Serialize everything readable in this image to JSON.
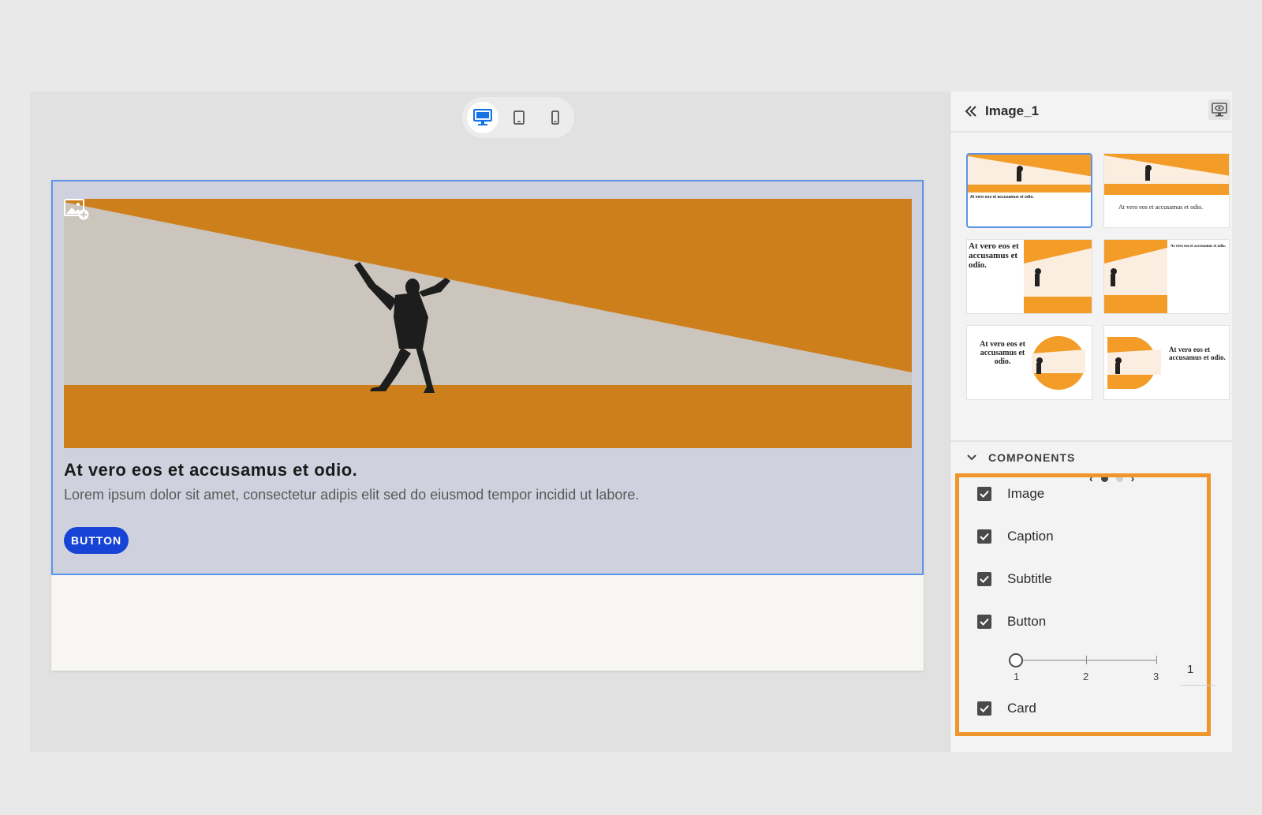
{
  "panel": {
    "title": "Image_1",
    "components_title": "COMPONENTS",
    "components": [
      {
        "label": "Image",
        "checked": true
      },
      {
        "label": "Caption",
        "checked": true
      },
      {
        "label": "Subtitle",
        "checked": true
      },
      {
        "label": "Button",
        "checked": true
      },
      {
        "label": "Card",
        "checked": true
      }
    ],
    "button_count": {
      "ticks": [
        "1",
        "2",
        "3"
      ],
      "value": "1"
    },
    "templates": [
      {
        "text": "At vero eos et accusamus et odio."
      },
      {
        "text": "At vero eos et accusamus et odio."
      },
      {
        "text": "At vero eos et accusamus et odio."
      },
      {
        "text": "At vero eos et accusamus et odio."
      },
      {
        "text": "At vero eos et accusamus et odio."
      },
      {
        "text": "At vero eos et accusamus et odio."
      }
    ],
    "pager": {
      "pages": 2,
      "current": 1
    }
  },
  "card": {
    "caption": "At vero eos et accusamus et odio.",
    "subtitle": "Lorem ipsum dolor sit amet, consectetur adipis elit sed do eiusmod tempor incidid ut labore.",
    "button": "BUTTON"
  },
  "colors": {
    "accent": "#1743d6",
    "banner": "#cd7f1c",
    "highlight": "#f0952b",
    "selection": "#5b95e8"
  }
}
